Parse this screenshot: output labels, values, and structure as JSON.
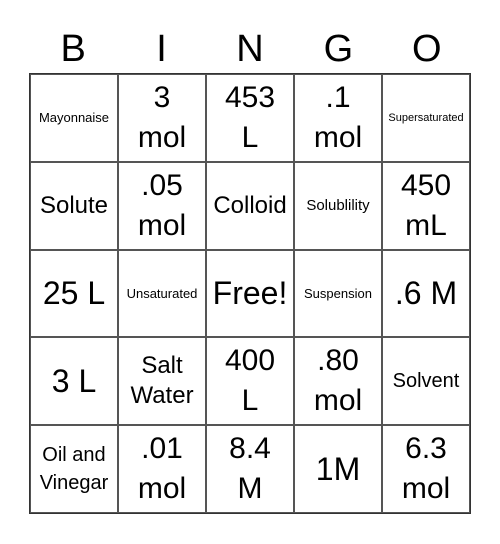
{
  "header": [
    "B",
    "I",
    "N",
    "G",
    "O"
  ],
  "cells": [
    {
      "text": "Mayonnaise",
      "size": "xxs"
    },
    {
      "text": "3\nmol",
      "size": "lg"
    },
    {
      "text": "453\nL",
      "size": "lg"
    },
    {
      "text": ".1\nmol",
      "size": "lg"
    },
    {
      "text": "Supersaturated",
      "size": "tiny"
    },
    {
      "text": "Solute",
      "size": "md"
    },
    {
      "text": ".05\nmol",
      "size": "lg"
    },
    {
      "text": "Colloid",
      "size": "md"
    },
    {
      "text": "Solublility",
      "size": "xs"
    },
    {
      "text": "450\nmL",
      "size": "lg"
    },
    {
      "text": "25 L",
      "size": "xl"
    },
    {
      "text": "Unsaturated",
      "size": "xxs"
    },
    {
      "text": "Free!",
      "size": "xl"
    },
    {
      "text": "Suspension",
      "size": "xxs"
    },
    {
      "text": ".6 M",
      "size": "xl"
    },
    {
      "text": "3 L",
      "size": "xl"
    },
    {
      "text": "Salt\nWater",
      "size": "md"
    },
    {
      "text": "400\nL",
      "size": "lg"
    },
    {
      "text": ".80\nmol",
      "size": "lg"
    },
    {
      "text": "Solvent",
      "size": "sm"
    },
    {
      "text": "Oil and\nVinegar",
      "size": "sm"
    },
    {
      "text": ".01\nmol",
      "size": "lg"
    },
    {
      "text": "8.4\nM",
      "size": "lg"
    },
    {
      "text": "1M",
      "size": "xl"
    },
    {
      "text": "6.3\nmol",
      "size": "lg"
    }
  ]
}
